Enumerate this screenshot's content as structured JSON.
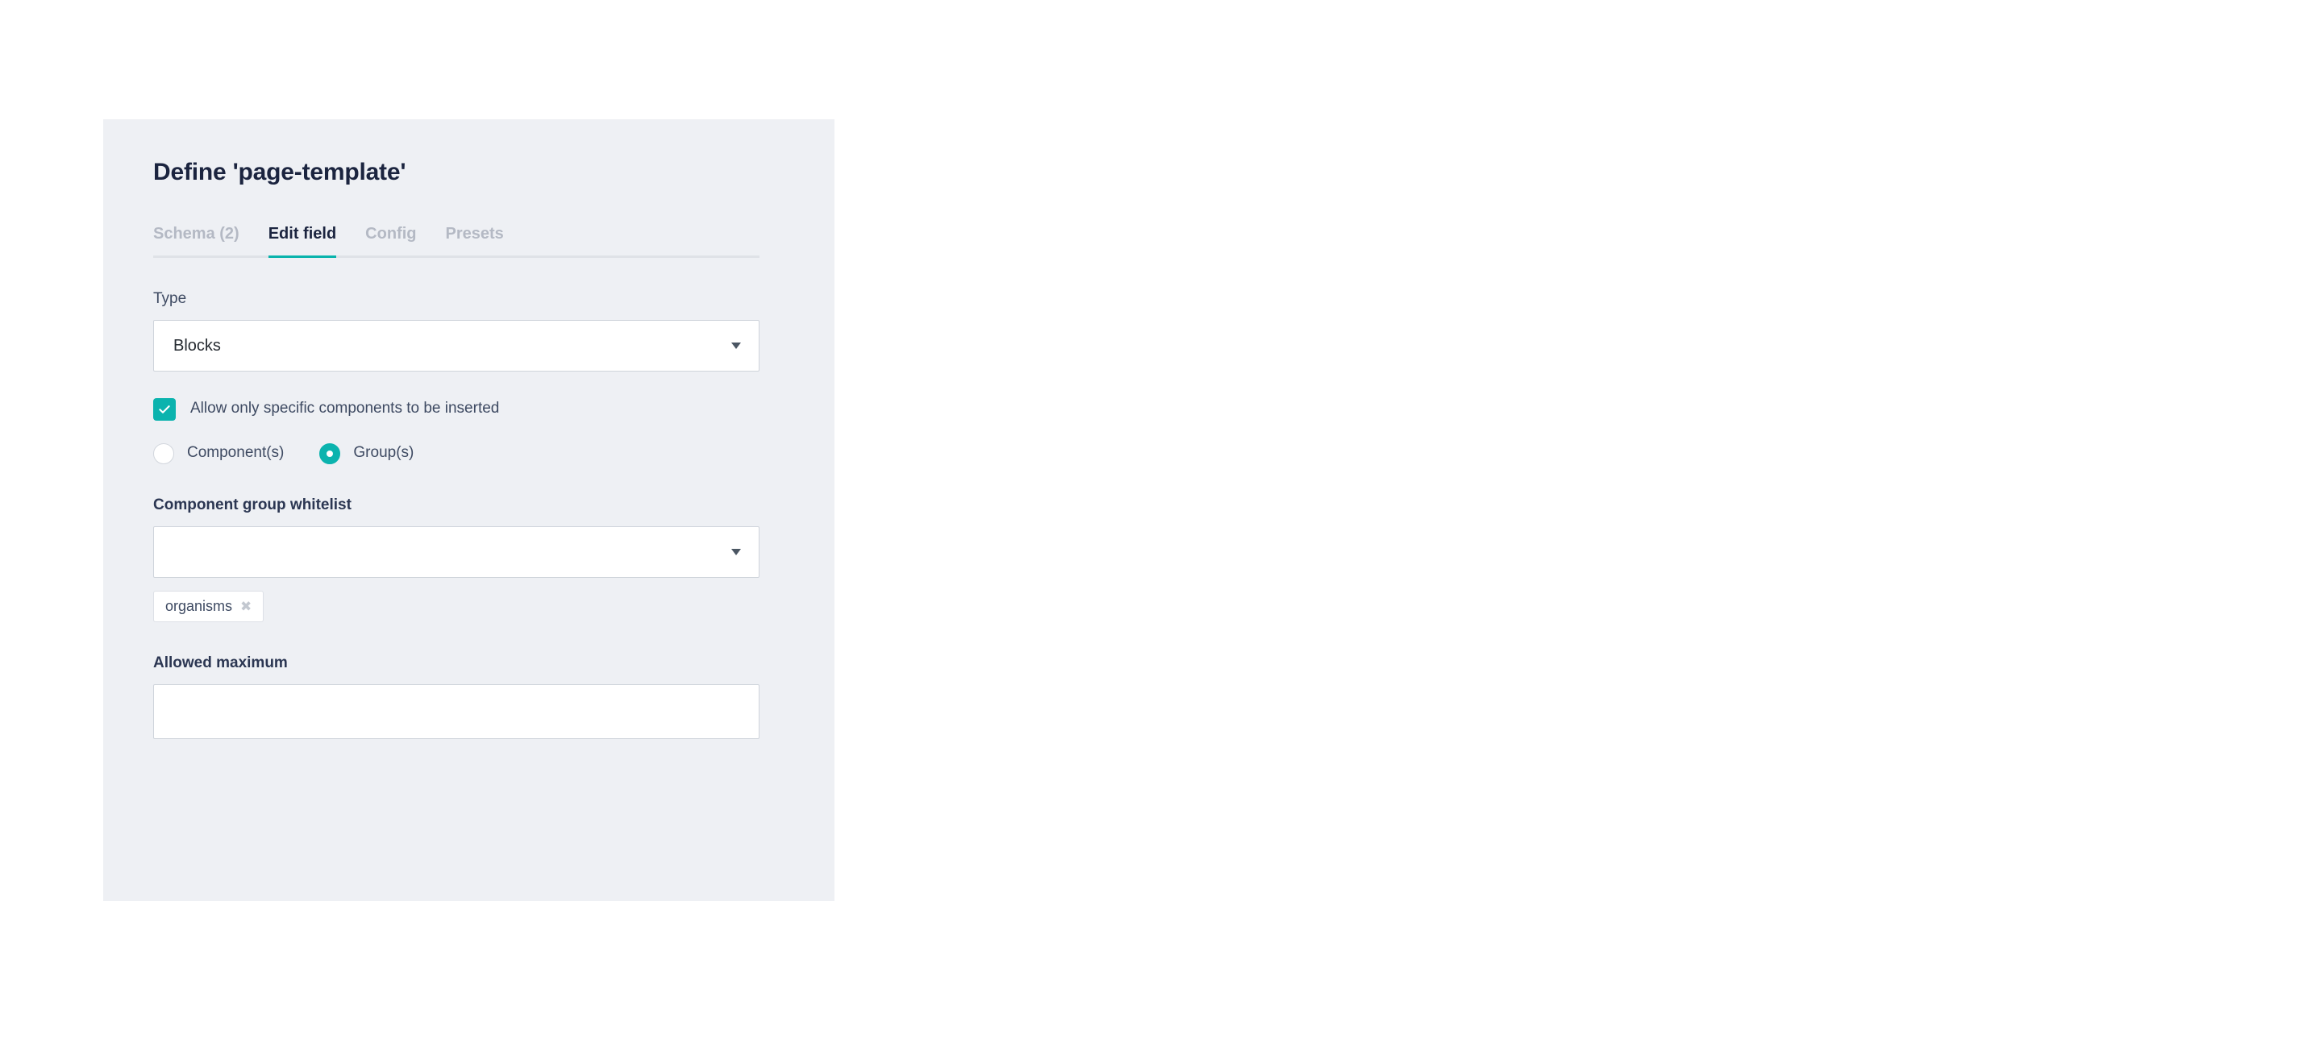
{
  "panel": {
    "title": "Define 'page-template'"
  },
  "tabs": [
    {
      "label": "Schema (2)",
      "active": false,
      "name": "tab-schema"
    },
    {
      "label": "Edit field",
      "active": true,
      "name": "tab-edit-field"
    },
    {
      "label": "Config",
      "active": false,
      "name": "tab-config"
    },
    {
      "label": "Presets",
      "active": false,
      "name": "tab-presets"
    }
  ],
  "type_field": {
    "label": "Type",
    "value": "Blocks"
  },
  "allow_specific": {
    "label": "Allow only specific components to be inserted",
    "checked": true
  },
  "scope_radios": {
    "components": {
      "label": "Component(s)",
      "selected": false
    },
    "groups": {
      "label": "Group(s)",
      "selected": true
    }
  },
  "whitelist_field": {
    "label": "Component group whitelist",
    "value": "",
    "placeholder": ""
  },
  "chips": [
    {
      "label": "organisms",
      "remove_icon": "✖"
    }
  ],
  "allowed_maximum_field": {
    "label": "Allowed maximum",
    "value": "",
    "placeholder": ""
  },
  "colors": {
    "accent": "#0bb3ae",
    "panel_bg": "#eef0f4",
    "title": "#1b243f",
    "label": "#3e4a62",
    "tab_inactive": "#b4b9c4",
    "border": "#cfd4db"
  }
}
